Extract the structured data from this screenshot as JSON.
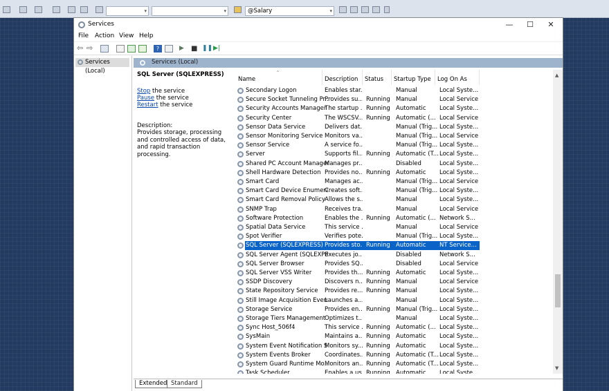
{
  "host": {
    "combo1": "",
    "combo2": "",
    "combo3": "@Salary"
  },
  "window": {
    "title": "Services",
    "menu": [
      "File",
      "Action",
      "View",
      "Help"
    ]
  },
  "tree": {
    "root": "Services (Local)"
  },
  "panel": {
    "header": "Services (Local)",
    "selected_name": "SQL Server (SQLEXPRESS)",
    "actions": [
      {
        "link": "Stop",
        "rest": " the service"
      },
      {
        "link": "Pause",
        "rest": " the service"
      },
      {
        "link": "Restart",
        "rest": " the service"
      }
    ],
    "description_label": "Description:",
    "description_text": "Provides storage, processing and controlled access of data, and rapid transaction processing."
  },
  "columns": [
    "Name",
    "Description",
    "Status",
    "Startup Type",
    "Log On As"
  ],
  "rows": [
    [
      "Secondary Logon",
      "Enables star...",
      "",
      "Manual",
      "Local Syste..."
    ],
    [
      "Secure Socket Tunneling Pr...",
      "Provides su...",
      "Running",
      "Manual",
      "Local Service"
    ],
    [
      "Security Accounts Manager",
      "The startup ...",
      "Running",
      "Automatic",
      "Local Syste..."
    ],
    [
      "Security Center",
      "The WSCSV...",
      "Running",
      "Automatic (...",
      "Local Service"
    ],
    [
      "Sensor Data Service",
      "Delivers dat...",
      "",
      "Manual (Trig...",
      "Local Syste..."
    ],
    [
      "Sensor Monitoring Service",
      "Monitors va...",
      "",
      "Manual (Trig...",
      "Local Service"
    ],
    [
      "Sensor Service",
      "A service fo...",
      "",
      "Manual (Trig...",
      "Local Syste..."
    ],
    [
      "Server",
      "Supports fil...",
      "Running",
      "Automatic (T...",
      "Local Syste..."
    ],
    [
      "Shared PC Account Manager",
      "Manages pr...",
      "",
      "Disabled",
      "Local Syste..."
    ],
    [
      "Shell Hardware Detection",
      "Provides no...",
      "Running",
      "Automatic",
      "Local Syste..."
    ],
    [
      "Smart Card",
      "Manages ac...",
      "",
      "Manual (Trig...",
      "Local Service"
    ],
    [
      "Smart Card Device Enumera...",
      "Creates soft...",
      "",
      "Manual (Trig...",
      "Local Syste..."
    ],
    [
      "Smart Card Removal Policy",
      "Allows the s...",
      "",
      "Manual",
      "Local Syste..."
    ],
    [
      "SNMP Trap",
      "Receives tra...",
      "",
      "Manual",
      "Local Service"
    ],
    [
      "Software Protection",
      "Enables the ...",
      "Running",
      "Automatic (...",
      "Network S..."
    ],
    [
      "Spatial Data Service",
      "This service ...",
      "",
      "Manual",
      "Local Service"
    ],
    [
      "Spot Verifier",
      "Verifies pote...",
      "",
      "Manual (Trig...",
      "Local Syste..."
    ],
    [
      "SQL Server (SQLEXPRESS)",
      "Provides sto...",
      "Running",
      "Automatic",
      "NT Service..."
    ],
    [
      "SQL Server Agent (SQLEXPR...",
      "Executes jo...",
      "",
      "Disabled",
      "Network S..."
    ],
    [
      "SQL Server Browser",
      "Provides SQ...",
      "",
      "Disabled",
      "Local Service"
    ],
    [
      "SQL Server VSS Writer",
      "Provides th...",
      "Running",
      "Automatic",
      "Local Syste..."
    ],
    [
      "SSDP Discovery",
      "Discovers n...",
      "Running",
      "Manual",
      "Local Service"
    ],
    [
      "State Repository Service",
      "Provides re...",
      "Running",
      "Manual",
      "Local Syste..."
    ],
    [
      "Still Image Acquisition Events",
      "Launches a...",
      "",
      "Manual",
      "Local Syste..."
    ],
    [
      "Storage Service",
      "Provides en...",
      "Running",
      "Manual (Trig...",
      "Local Syste..."
    ],
    [
      "Storage Tiers Management",
      "Optimizes t...",
      "",
      "Manual",
      "Local Syste..."
    ],
    [
      "Sync Host_506f4",
      "This service ...",
      "Running",
      "Automatic (...",
      "Local Syste..."
    ],
    [
      "SysMain",
      "Maintains a...",
      "Running",
      "Automatic",
      "Local Syste..."
    ],
    [
      "System Event Notification S...",
      "Monitors sy...",
      "Running",
      "Automatic",
      "Local Syste..."
    ],
    [
      "System Events Broker",
      "Coordinates...",
      "Running",
      "Automatic (T...",
      "Local Syste..."
    ],
    [
      "System Guard Runtime Mo...",
      "Monitors an...",
      "Running",
      "Automatic (T...",
      "Local Syste..."
    ],
    [
      "Task Scheduler",
      "Enables a us...",
      "Running",
      "Automatic",
      "Local Syste..."
    ]
  ],
  "selected_row": 17,
  "tabs": [
    "Extended",
    "Standard"
  ]
}
